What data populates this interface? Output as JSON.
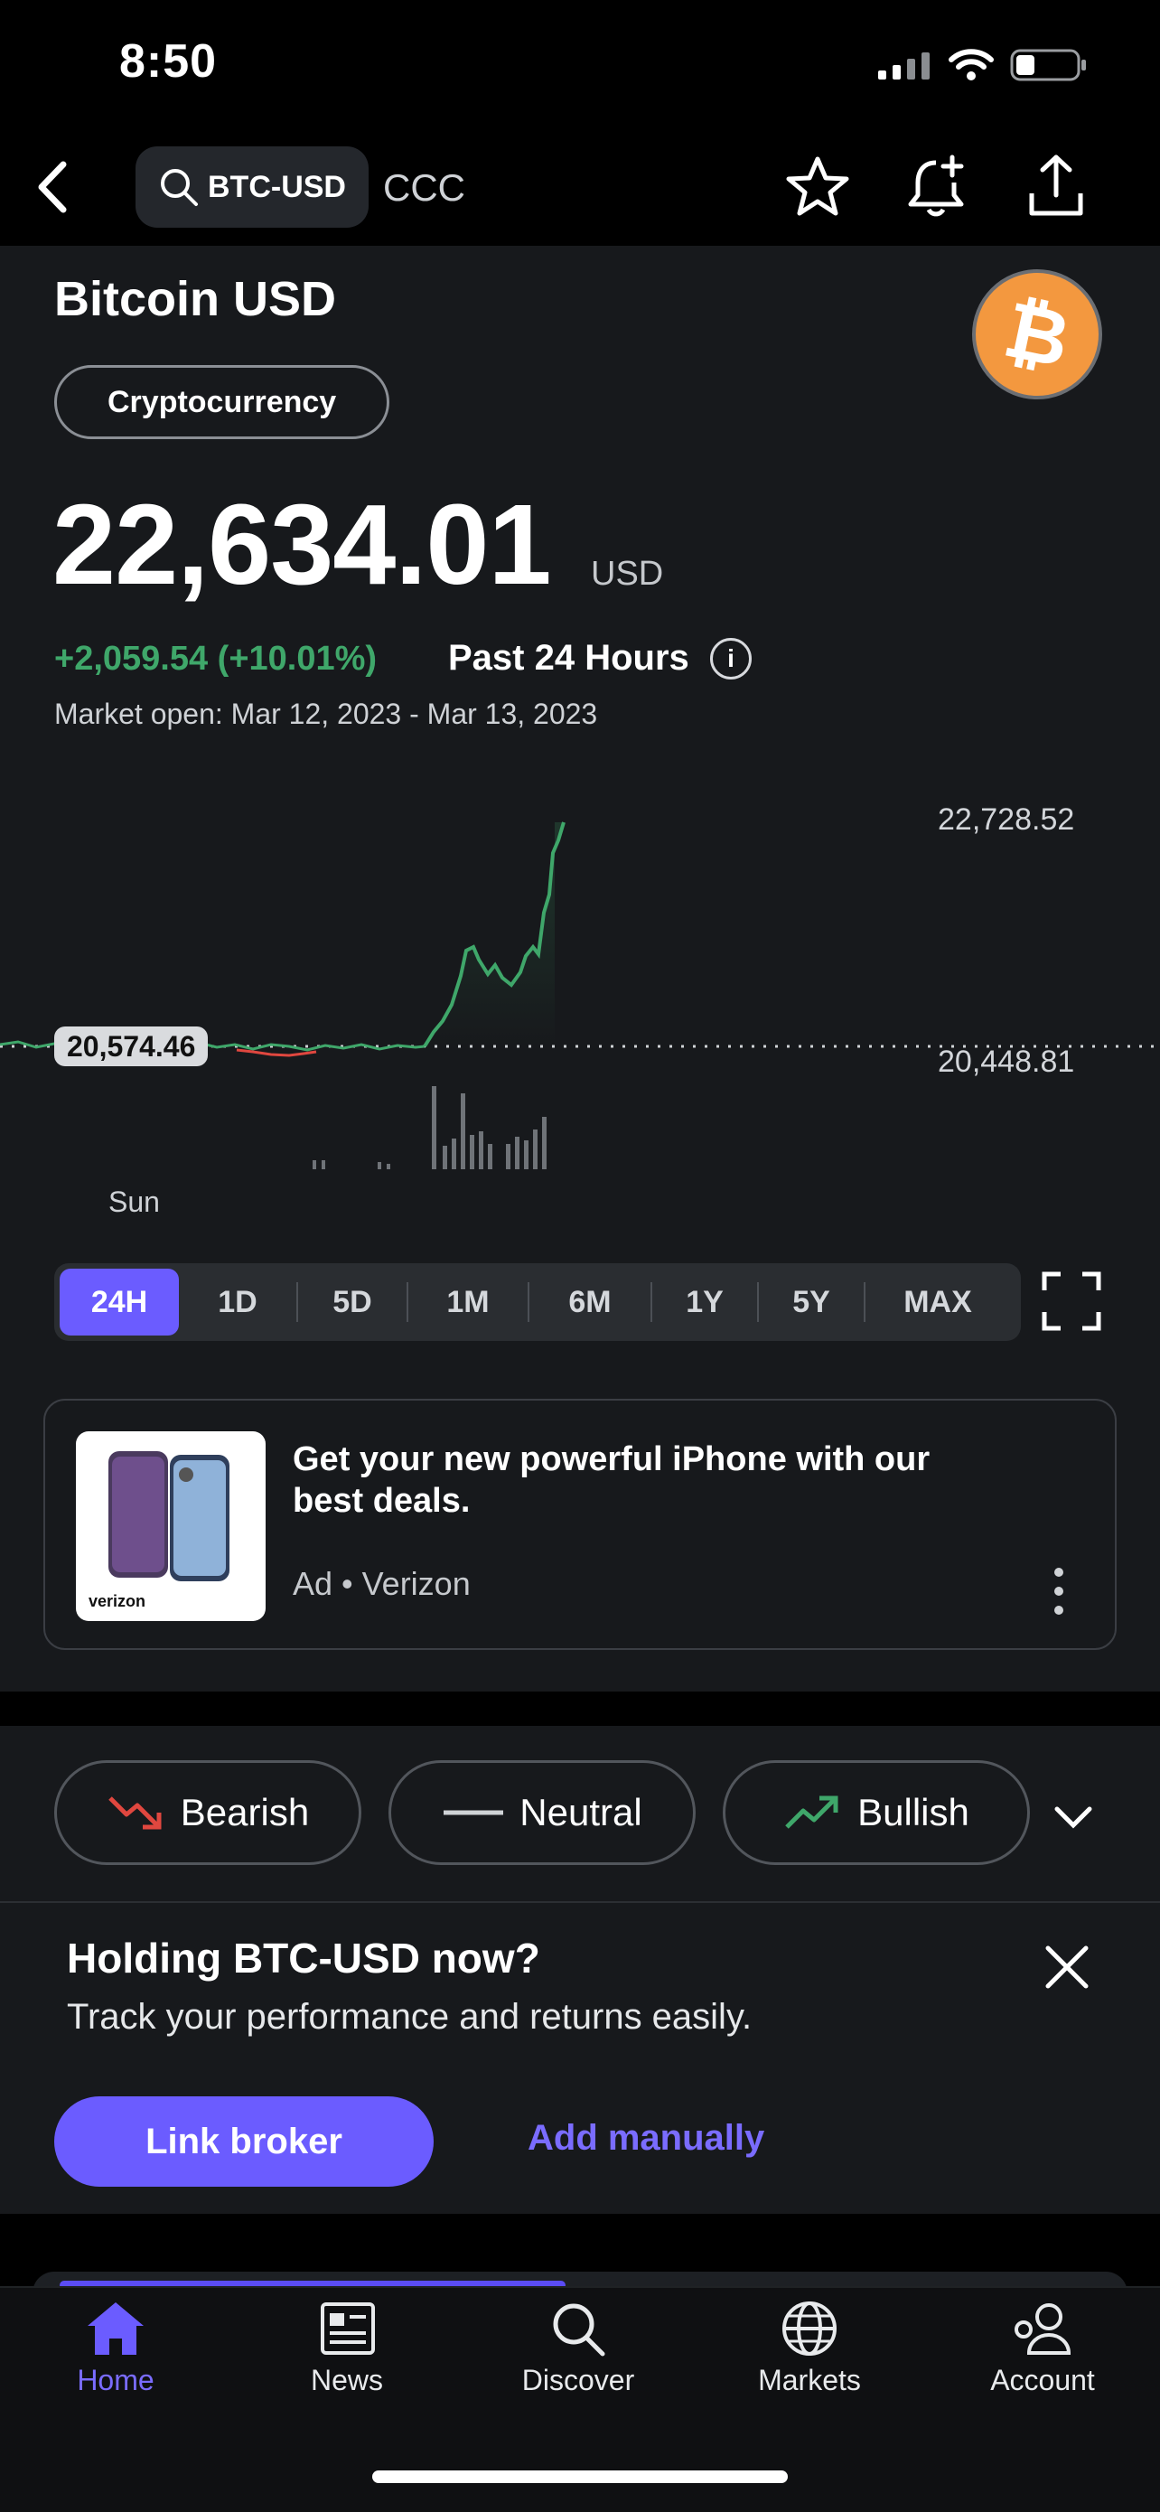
{
  "status_bar": {
    "time": "8:50"
  },
  "header": {
    "search_symbol": "BTC-USD",
    "sub_label": "CCC"
  },
  "quote": {
    "name": "Bitcoin USD",
    "category": "Cryptocurrency",
    "price": "22,634.01",
    "currency": "USD",
    "change": "+2,059.54 (+10.01%)",
    "period": "Past 24 Hours",
    "market_open": "Market open: Mar 12, 2023 - Mar 13, 2023"
  },
  "chart": {
    "high_label": "22,728.52",
    "low_label": "20,448.81",
    "base_label": "20,574.46",
    "x_label": "Sun",
    "colors": {
      "up": "#3fa76a",
      "down": "#e0473f"
    }
  },
  "ranges": [
    "24H",
    "1D",
    "5D",
    "1M",
    "6M",
    "1Y",
    "5Y",
    "MAX"
  ],
  "active_range": "24H",
  "ad": {
    "title": "Get your new powerful iPhone with our best deals.",
    "meta": "Ad • Verizon",
    "brand": "verizon"
  },
  "sentiment": {
    "bearish": "Bearish",
    "neutral": "Neutral",
    "bullish": "Bullish"
  },
  "holding": {
    "title": "Holding BTC-USD now?",
    "subtitle": "Track your performance and returns easily.",
    "link_broker": "Link broker",
    "add_manually": "Add manually"
  },
  "tabbar": {
    "home": "Home",
    "news": "News",
    "discover": "Discover",
    "markets": "Markets",
    "account": "Account"
  },
  "accent_color": "#6b5cff"
}
